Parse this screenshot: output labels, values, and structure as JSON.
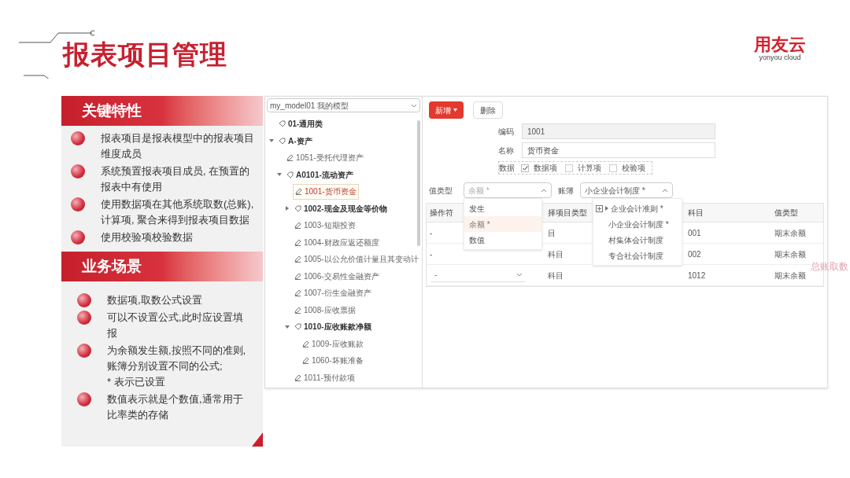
{
  "slide": {
    "title": "报表项目管理",
    "logo": {
      "name": "用友云",
      "tagline": "yonyou cloud"
    },
    "note": "总账取数"
  },
  "sections": [
    {
      "heading": "关键特性",
      "bullets": [
        "报表项目是报表模型中的报表项目维度成员",
        "系统预置报表项目成员, 在预置的报表中有使用",
        "使用数据项在其他系统取数(总账), 计算项, 聚合来得到报表项目数据",
        "使用校验项校验数据"
      ]
    },
    {
      "heading": "业务场景",
      "bullets": [
        "数据项,取数公式设置",
        "可以不设置公式,此时应设置填报",
        "为余额发生额,按照不同的准则,账簿分别设置不同的公式;\n* 表示已设置",
        "数值表示就是个数值,通常用于比率类的存储"
      ]
    }
  ],
  "app": {
    "model_select": "my_model01 我的模型",
    "tree": [
      {
        "label": "01-通用类",
        "kind": "group",
        "selected": false
      },
      {
        "label": "A-资产",
        "kind": "group",
        "expanded": true,
        "selected": false,
        "children": [
          {
            "label": "1051-受托代理资产",
            "kind": "item",
            "selected": false
          },
          {
            "label": "A0101-流动资产",
            "kind": "group",
            "expanded": true,
            "selected": false,
            "children": [
              {
                "label": "1001-货币资金",
                "kind": "item",
                "selected": true
              },
              {
                "label": "1002-现金及现金等价物",
                "kind": "group",
                "expanded": false,
                "selected": false
              },
              {
                "label": "1003-短期投资",
                "kind": "item",
                "selected": false
              },
              {
                "label": "1004-财政应返还额度",
                "kind": "item",
                "selected": false
              },
              {
                "label": "1005-以公允价值计量且其变动计",
                "kind": "item",
                "selected": false
              },
              {
                "label": "1006-交易性金融资产",
                "kind": "item",
                "selected": false
              },
              {
                "label": "1007-衍生金融资产",
                "kind": "item",
                "selected": false
              },
              {
                "label": "1008-应收票据",
                "kind": "item",
                "selected": false
              },
              {
                "label": "1010-应收账款净额",
                "kind": "group",
                "expanded": true,
                "selected": false,
                "children": [
                  {
                    "label": "1009-应收账款",
                    "kind": "item",
                    "selected": false
                  },
                  {
                    "label": "1060-坏账准备",
                    "kind": "item",
                    "selected": false
                  }
                ]
              },
              {
                "label": "1011-预付款项",
                "kind": "item",
                "selected": false
              }
            ]
          }
        ]
      }
    ],
    "toolbar": [
      {
        "label": "新增",
        "kind": "primary"
      },
      {
        "label": "删除",
        "kind": "default"
      }
    ],
    "fields": [
      {
        "label": "编码",
        "value": "1001",
        "disabled": true
      },
      {
        "label": "名称",
        "value": "货币资金",
        "disabled": false
      }
    ],
    "data_type": {
      "label": "数据",
      "options": [
        {
          "label": "数据项",
          "checked": true
        },
        {
          "label": "计算项",
          "checked": false
        },
        {
          "label": "校验项",
          "checked": false
        }
      ]
    },
    "value_type": {
      "label": "值类型",
      "placeholder": "余额 *",
      "expanded": true
    },
    "ledger": {
      "label": "账簿",
      "value": "小企业会计制度 *",
      "expanded": true
    },
    "value_type_menu": [
      {
        "label": "发生",
        "selected": false
      },
      {
        "label": "余额 *",
        "selected": true
      },
      {
        "label": "数值",
        "selected": false
      }
    ],
    "ledger_menu": [
      {
        "label": "企业会计准则 *",
        "kind": "parent"
      },
      {
        "label": "小企业会计制度 *",
        "kind": "item"
      },
      {
        "label": "村集体会计制度",
        "kind": "item"
      },
      {
        "label": "专合社会计制度",
        "kind": "item"
      }
    ],
    "table": {
      "columns": [
        "操作符",
        "择项目类型",
        "科目",
        "值类型"
      ],
      "rows": [
        {
          "kind": "text",
          "cells": [
            "-",
            "目",
            "001",
            "期末余额"
          ]
        },
        {
          "kind": "text",
          "cells": [
            "-",
            "科目",
            "002",
            "期末余额"
          ]
        },
        {
          "kind": "select",
          "cells": [
            "-",
            "科目",
            "1012",
            "期末余额"
          ]
        }
      ]
    }
  }
}
